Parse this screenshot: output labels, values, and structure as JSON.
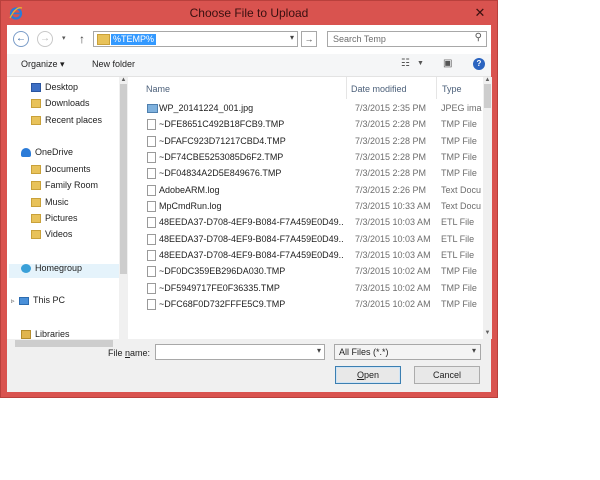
{
  "window": {
    "title": "Choose File to Upload",
    "close_glyph": "✕"
  },
  "address": {
    "back_glyph": "←",
    "forward_glyph": "→",
    "history_glyph": "▾",
    "up_glyph": "↑",
    "path": "%TEMP%",
    "refresh_glyph": "→",
    "search_placeholder": "Search Temp",
    "search_icon": "search-icon"
  },
  "toolbar": {
    "organize": "Organize ▾",
    "new_folder": "New folder",
    "help": "?"
  },
  "nav": {
    "items": [
      {
        "label": "Desktop",
        "icon": "desktop-icon"
      },
      {
        "label": "Downloads",
        "icon": "downloads-icon"
      },
      {
        "label": "Recent places",
        "icon": "recent-places-icon"
      },
      {
        "label": "OneDrive",
        "icon": "onedrive-icon"
      },
      {
        "label": "Documents",
        "icon": "folder-icon"
      },
      {
        "label": "Family Room",
        "icon": "folder-icon"
      },
      {
        "label": "Music",
        "icon": "folder-icon"
      },
      {
        "label": "Pictures",
        "icon": "folder-icon"
      },
      {
        "label": "Videos",
        "icon": "folder-icon"
      },
      {
        "label": "Homegroup",
        "icon": "homegroup-icon"
      },
      {
        "label": "This PC",
        "icon": "this-pc-icon"
      },
      {
        "label": "Libraries",
        "icon": "libraries-icon"
      }
    ]
  },
  "columns": {
    "name": "Name",
    "date": "Date modified",
    "type": "Type"
  },
  "files": [
    {
      "name": "WP_20141224_001.jpg",
      "date": "7/3/2015 2:35 PM",
      "type": "JPEG ima"
    },
    {
      "name": "~DFE8651C492B18FCB9.TMP",
      "date": "7/3/2015 2:28 PM",
      "type": "TMP File"
    },
    {
      "name": "~DFAFC923D71217CBD4.TMP",
      "date": "7/3/2015 2:28 PM",
      "type": "TMP File"
    },
    {
      "name": "~DF74CBE5253085D6F2.TMP",
      "date": "7/3/2015 2:28 PM",
      "type": "TMP File"
    },
    {
      "name": "~DF04834A2D5E849676.TMP",
      "date": "7/3/2015 2:28 PM",
      "type": "TMP File"
    },
    {
      "name": "AdobeARM.log",
      "date": "7/3/2015 2:26 PM",
      "type": "Text Docu"
    },
    {
      "name": "MpCmdRun.log",
      "date": "7/3/2015 10:33 AM",
      "type": "Text Docu"
    },
    {
      "name": "48EEDA37-D708-4EF9-B084-F7A459E0D49...",
      "date": "7/3/2015 10:03 AM",
      "type": "ETL File"
    },
    {
      "name": "48EEDA37-D708-4EF9-B084-F7A459E0D49...",
      "date": "7/3/2015 10:03 AM",
      "type": "ETL File"
    },
    {
      "name": "48EEDA37-D708-4EF9-B084-F7A459E0D49...",
      "date": "7/3/2015 10:03 AM",
      "type": "ETL File"
    },
    {
      "name": "~DF0DC359EB296DA030.TMP",
      "date": "7/3/2015 10:02 AM",
      "type": "TMP File"
    },
    {
      "name": "~DF5949717FE0F36335.TMP",
      "date": "7/3/2015 10:02 AM",
      "type": "TMP File"
    },
    {
      "name": "~DFC68F0D732FFFE5C9.TMP",
      "date": "7/3/2015 10:02 AM",
      "type": "TMP File"
    }
  ],
  "bottom": {
    "file_name_label_pre": "File ",
    "file_name_label_u": "n",
    "file_name_label_post": "ame:",
    "file_name_value": "",
    "file_type": "All Files (*.*)",
    "open_u": "O",
    "open_rest": "pen",
    "cancel": "Cancel"
  }
}
